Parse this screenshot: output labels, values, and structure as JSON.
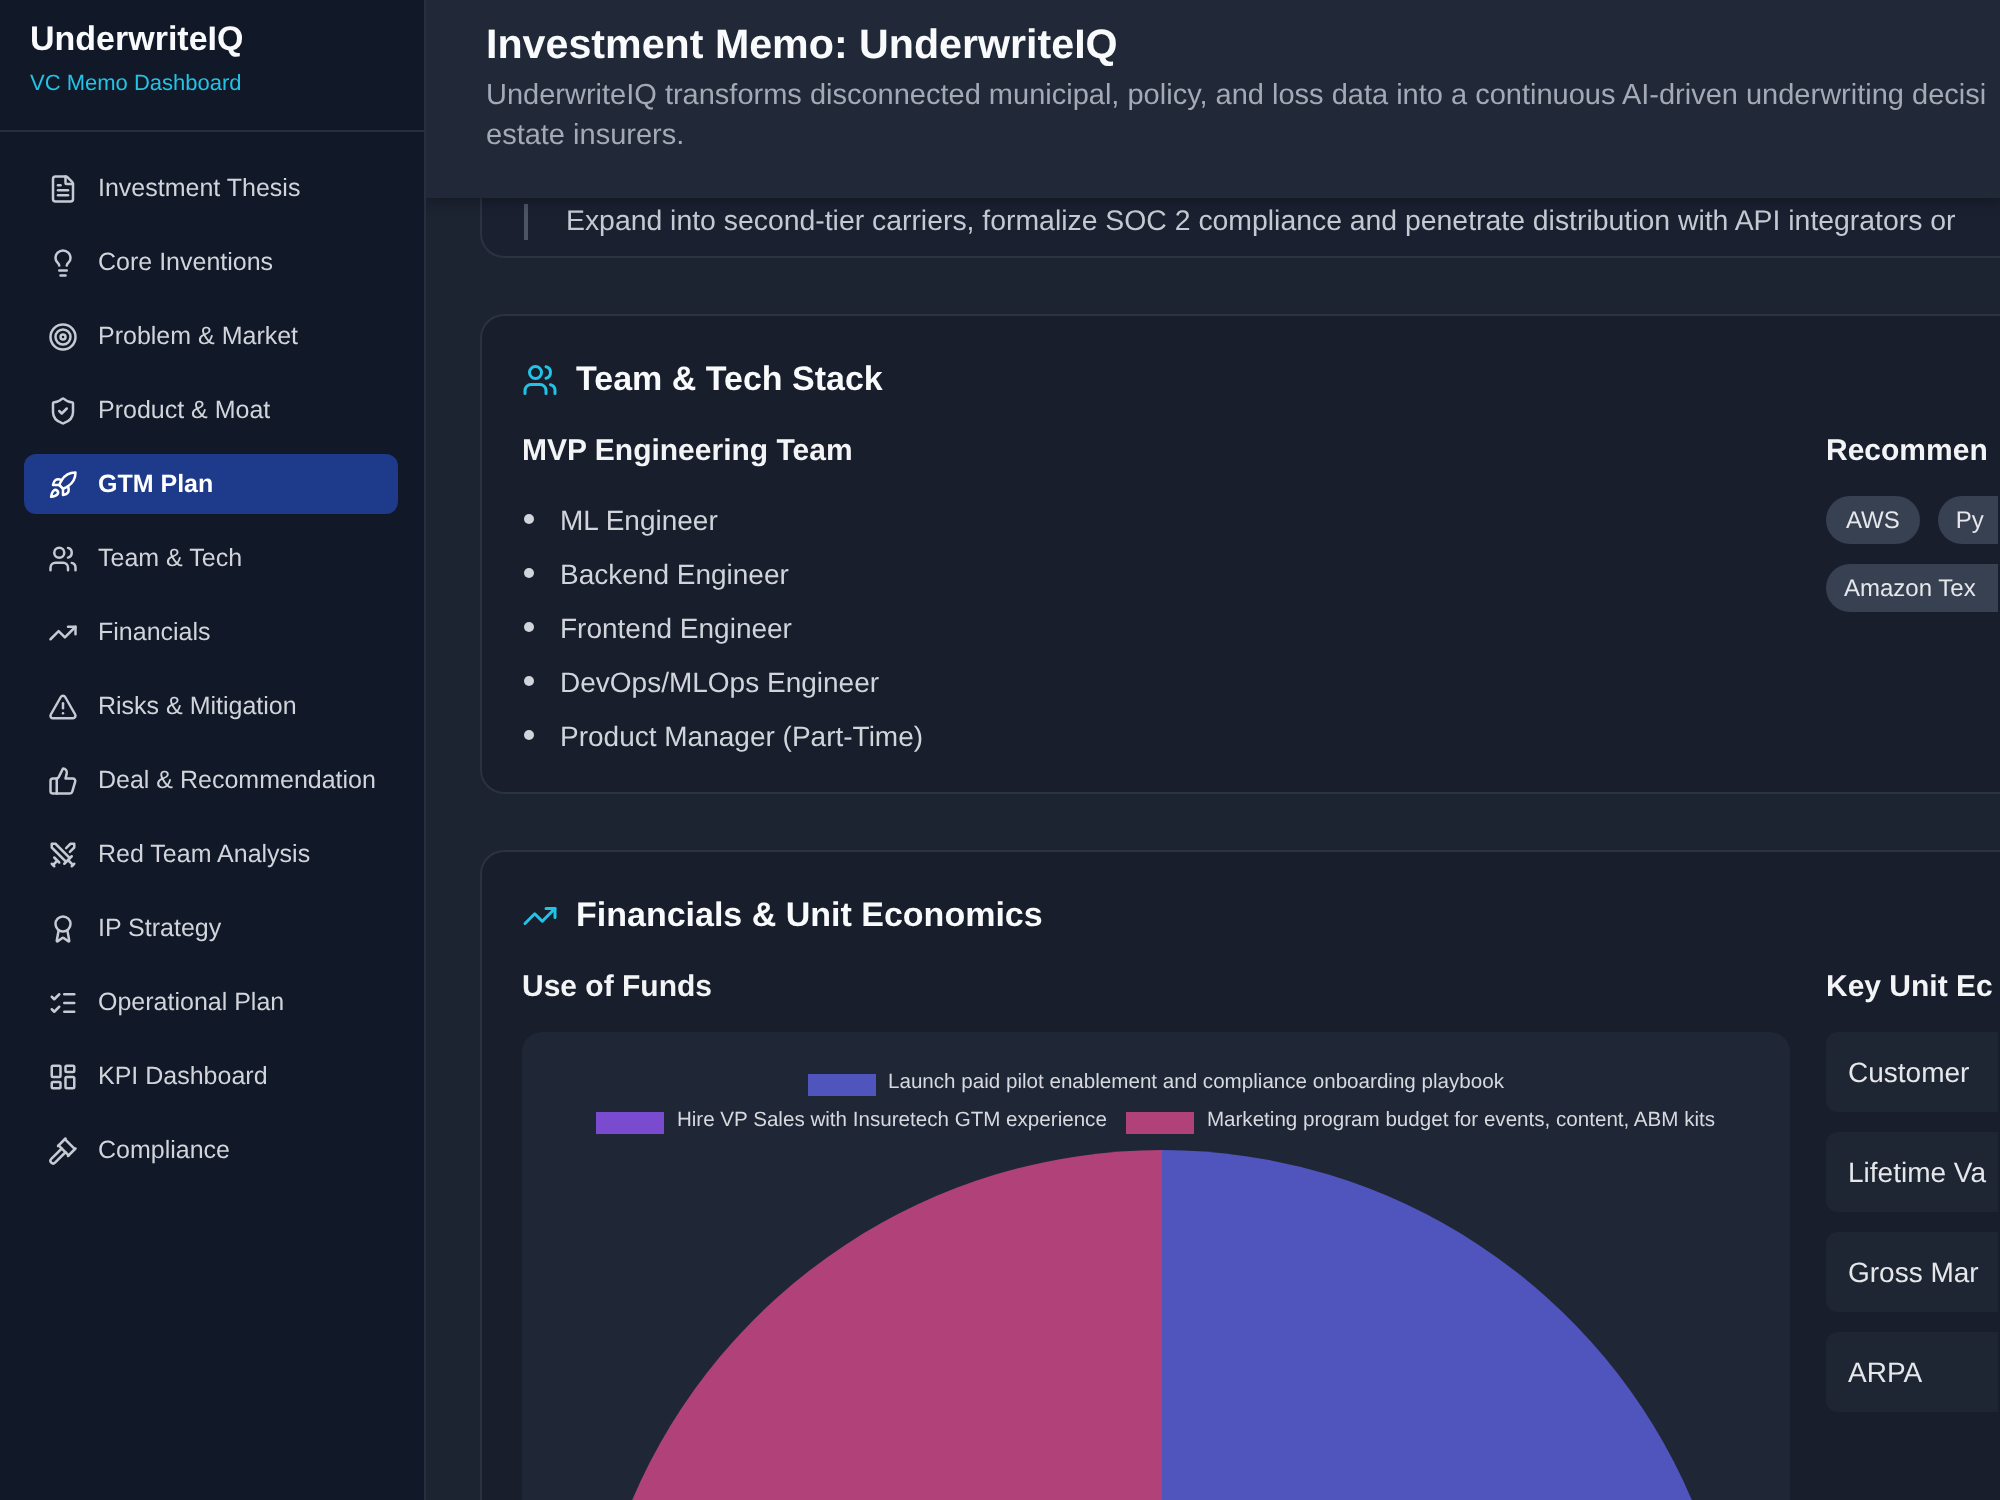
{
  "sidebar": {
    "brand": "UnderwriteIQ",
    "tagline": "VC Memo Dashboard",
    "items": [
      {
        "label": "Investment Thesis",
        "selected": false
      },
      {
        "label": "Core Inventions",
        "selected": false
      },
      {
        "label": "Problem & Market",
        "selected": false
      },
      {
        "label": "Product & Moat",
        "selected": false
      },
      {
        "label": "GTM Plan",
        "selected": true
      },
      {
        "label": "Team & Tech",
        "selected": false
      },
      {
        "label": "Financials",
        "selected": false
      },
      {
        "label": "Risks & Mitigation",
        "selected": false
      },
      {
        "label": "Deal & Recommendation",
        "selected": false
      },
      {
        "label": "Red Team Analysis",
        "selected": false
      },
      {
        "label": "IP Strategy",
        "selected": false
      },
      {
        "label": "Operational Plan",
        "selected": false
      },
      {
        "label": "KPI Dashboard",
        "selected": false
      },
      {
        "label": "Compliance",
        "selected": false
      }
    ]
  },
  "header": {
    "title": "Investment Memo: UnderwriteIQ",
    "description_lines": [
      "UnderwriteIQ transforms disconnected municipal, policy, and loss data into a continuous AI-driven underwriting decisi",
      "estate insurers."
    ]
  },
  "previous_section": {
    "milestone": "Expand into second-tier carriers, formalize SOC 2 compliance and penetrate distribution with API integrators or"
  },
  "team": {
    "title": "Team & Tech Stack",
    "team_heading": "MVP Engineering Team",
    "members": [
      "ML Engineer",
      "Backend Engineer",
      "Frontend Engineer",
      "DevOps/MLOps Engineer",
      "Product Manager (Part-Time)"
    ],
    "stack_heading": "Recommen",
    "stack_tag_rows": [
      [
        "AWS",
        "Py"
      ],
      [
        "Amazon Tex"
      ]
    ]
  },
  "financials": {
    "title": "Financials & Unit Economics",
    "funds_heading": "Use of Funds",
    "legend": [
      {
        "label": "Launch paid pilot enablement and compliance onboarding playbook",
        "color": "#5055bd"
      },
      {
        "label": "Hire VP Sales with Insuretech GTM experience",
        "color": "#7a4bcf"
      },
      {
        "label": "Marketing program budget for events, content, ABM kits",
        "color": "#b14179"
      }
    ],
    "metrics_heading": "Key Unit Ec",
    "metrics": [
      "Customer",
      "Lifetime Va",
      "Gross Mar",
      "ARPA"
    ]
  }
}
